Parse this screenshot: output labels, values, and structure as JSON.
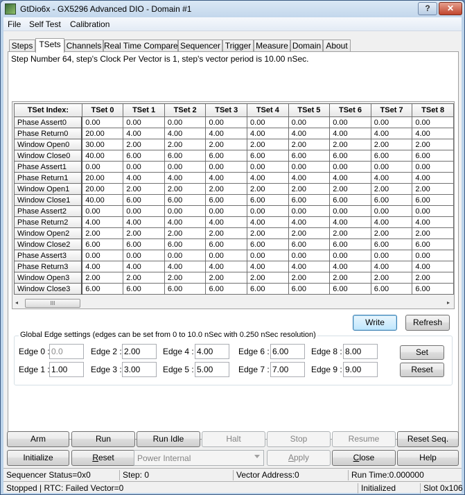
{
  "window": {
    "title": "GtDio6x - GX5296 Advanced DIO - Domain #1",
    "help_glyph": "?",
    "close_glyph": "✕"
  },
  "menu": [
    "File",
    "Self Test",
    "Calibration"
  ],
  "tabs": [
    {
      "label": "Steps",
      "active": false
    },
    {
      "label": "TSets",
      "active": true
    },
    {
      "label": "Channels",
      "active": false
    },
    {
      "label": "Real Time Compare",
      "active": false
    },
    {
      "label": "Sequencer",
      "active": false
    },
    {
      "label": "Trigger",
      "active": false
    },
    {
      "label": "Measure",
      "active": false
    },
    {
      "label": "Domain",
      "active": false
    },
    {
      "label": "About",
      "active": false
    }
  ],
  "step_info": "Step Number 64, step's Clock Per Vector is 1, step's vector period is 10.00 nSec.",
  "grid": {
    "corner": "TSet Index:",
    "columns": [
      "TSet 0",
      "TSet 1",
      "TSet 2",
      "TSet 3",
      "TSet 4",
      "TSet 5",
      "TSet 6",
      "TSet 7",
      "TSet 8"
    ],
    "rows": [
      {
        "label": "Phase Assert0",
        "values": [
          "0.00",
          "0.00",
          "0.00",
          "0.00",
          "0.00",
          "0.00",
          "0.00",
          "0.00",
          "0.00"
        ]
      },
      {
        "label": "Phase Return0",
        "values": [
          "20.00",
          "4.00",
          "4.00",
          "4.00",
          "4.00",
          "4.00",
          "4.00",
          "4.00",
          "4.00"
        ]
      },
      {
        "label": "Window Open0",
        "values": [
          "30.00",
          "2.00",
          "2.00",
          "2.00",
          "2.00",
          "2.00",
          "2.00",
          "2.00",
          "2.00"
        ]
      },
      {
        "label": "Window Close0",
        "values": [
          "40.00",
          "6.00",
          "6.00",
          "6.00",
          "6.00",
          "6.00",
          "6.00",
          "6.00",
          "6.00"
        ]
      },
      {
        "label": "Phase Assert1",
        "values": [
          "0.00",
          "0.00",
          "0.00",
          "0.00",
          "0.00",
          "0.00",
          "0.00",
          "0.00",
          "0.00"
        ]
      },
      {
        "label": "Phase Return1",
        "values": [
          "20.00",
          "4.00",
          "4.00",
          "4.00",
          "4.00",
          "4.00",
          "4.00",
          "4.00",
          "4.00"
        ]
      },
      {
        "label": "Window Open1",
        "values": [
          "20.00",
          "2.00",
          "2.00",
          "2.00",
          "2.00",
          "2.00",
          "2.00",
          "2.00",
          "2.00"
        ]
      },
      {
        "label": "Window Close1",
        "values": [
          "40.00",
          "6.00",
          "6.00",
          "6.00",
          "6.00",
          "6.00",
          "6.00",
          "6.00",
          "6.00"
        ]
      },
      {
        "label": "Phase Assert2",
        "values": [
          "0.00",
          "0.00",
          "0.00",
          "0.00",
          "0.00",
          "0.00",
          "0.00",
          "0.00",
          "0.00"
        ]
      },
      {
        "label": "Phase Return2",
        "values": [
          "4.00",
          "4.00",
          "4.00",
          "4.00",
          "4.00",
          "4.00",
          "4.00",
          "4.00",
          "4.00"
        ]
      },
      {
        "label": "Window Open2",
        "values": [
          "2.00",
          "2.00",
          "2.00",
          "2.00",
          "2.00",
          "2.00",
          "2.00",
          "2.00",
          "2.00"
        ]
      },
      {
        "label": "Window Close2",
        "values": [
          "6.00",
          "6.00",
          "6.00",
          "6.00",
          "6.00",
          "6.00",
          "6.00",
          "6.00",
          "6.00"
        ]
      },
      {
        "label": "Phase Assert3",
        "values": [
          "0.00",
          "0.00",
          "0.00",
          "0.00",
          "0.00",
          "0.00",
          "0.00",
          "0.00",
          "0.00"
        ]
      },
      {
        "label": "Phase Return3",
        "values": [
          "4.00",
          "4.00",
          "4.00",
          "4.00",
          "4.00",
          "4.00",
          "4.00",
          "4.00",
          "4.00"
        ]
      },
      {
        "label": "Window Open3",
        "values": [
          "2.00",
          "2.00",
          "2.00",
          "2.00",
          "2.00",
          "2.00",
          "2.00",
          "2.00",
          "2.00"
        ]
      },
      {
        "label": "Window Close3",
        "values": [
          "6.00",
          "6.00",
          "6.00",
          "6.00",
          "6.00",
          "6.00",
          "6.00",
          "6.00",
          "6.00"
        ]
      }
    ],
    "scroll_left_glyph": "◂",
    "scroll_thumb_glyph": "III",
    "scroll_right_glyph": "▸"
  },
  "actions": {
    "write": "Write",
    "refresh": "Refresh"
  },
  "edges": {
    "title": "Global Edge settings (edges can be set from 0 to 10.0 nSec with 0.250 nSec resolution)",
    "items": [
      {
        "label": "Edge 0 :",
        "value": "0.0",
        "disabled": true
      },
      {
        "label": "Edge 1 :",
        "value": "1.00"
      },
      {
        "label": "Edge 2 :",
        "value": "2.00"
      },
      {
        "label": "Edge 3 :",
        "value": "3.00"
      },
      {
        "label": "Edge 4 :",
        "value": "4.00"
      },
      {
        "label": "Edge 5 :",
        "value": "5.00"
      },
      {
        "label": "Edge 6 :",
        "value": "6.00"
      },
      {
        "label": "Edge 7 :",
        "value": "7.00"
      },
      {
        "label": "Edge 8 :",
        "value": "8.00"
      },
      {
        "label": "Edge 9 :",
        "value": "9.00"
      }
    ],
    "set": "Set",
    "reset": "Reset"
  },
  "controls": {
    "arm": "Arm",
    "run": "Run",
    "run_idle": "Run Idle",
    "halt": "Halt",
    "stop": "Stop",
    "resume": "Resume",
    "reset_seq": "Reset Seq.",
    "initialize": "Initialize",
    "reset_first": "R",
    "reset_rest": "eset",
    "power_select": "Power Internal",
    "apply_first": "A",
    "apply_rest": "pply",
    "close_first": "C",
    "close_rest": "lose",
    "help": "Help"
  },
  "status": {
    "seq_status": "Sequencer Status=0x0",
    "step": "Step: 0",
    "vector_address": "Vector Address:0",
    "run_time": "Run Time:0.000000",
    "state": "Stopped | RTC: Failed Vector=0",
    "init_state": "Initialized",
    "slot": "Slot 0x106"
  }
}
